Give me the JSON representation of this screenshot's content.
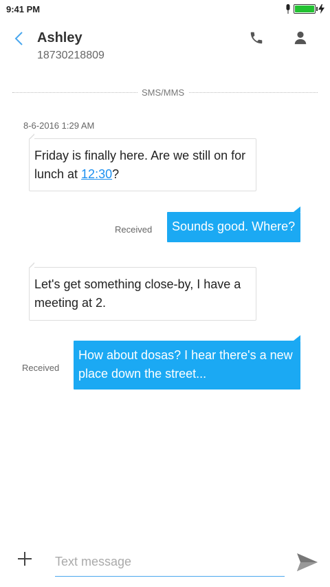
{
  "status": {
    "time": "9:41 PM"
  },
  "header": {
    "name": "Ashley",
    "number": "18730218809"
  },
  "conversation": {
    "divider_label": "SMS/MMS",
    "timestamp": "8-6-2016 1:29 AM",
    "messages": [
      {
        "direction": "in",
        "text_before": "Friday is finally here. Are we still on for lunch at ",
        "link": "12:30",
        "text_after": "?"
      },
      {
        "direction": "out",
        "text": "Sounds good. Where?",
        "status": "Received"
      },
      {
        "direction": "in",
        "text": "Let's get something close-by, I have a meeting at 2."
      },
      {
        "direction": "out",
        "text": "How about dosas? I hear there's a new place down the street...",
        "status": "Received"
      }
    ]
  },
  "compose": {
    "placeholder": "Text message"
  },
  "colors": {
    "accent": "#1ba9f3",
    "battery": "#22c232"
  }
}
